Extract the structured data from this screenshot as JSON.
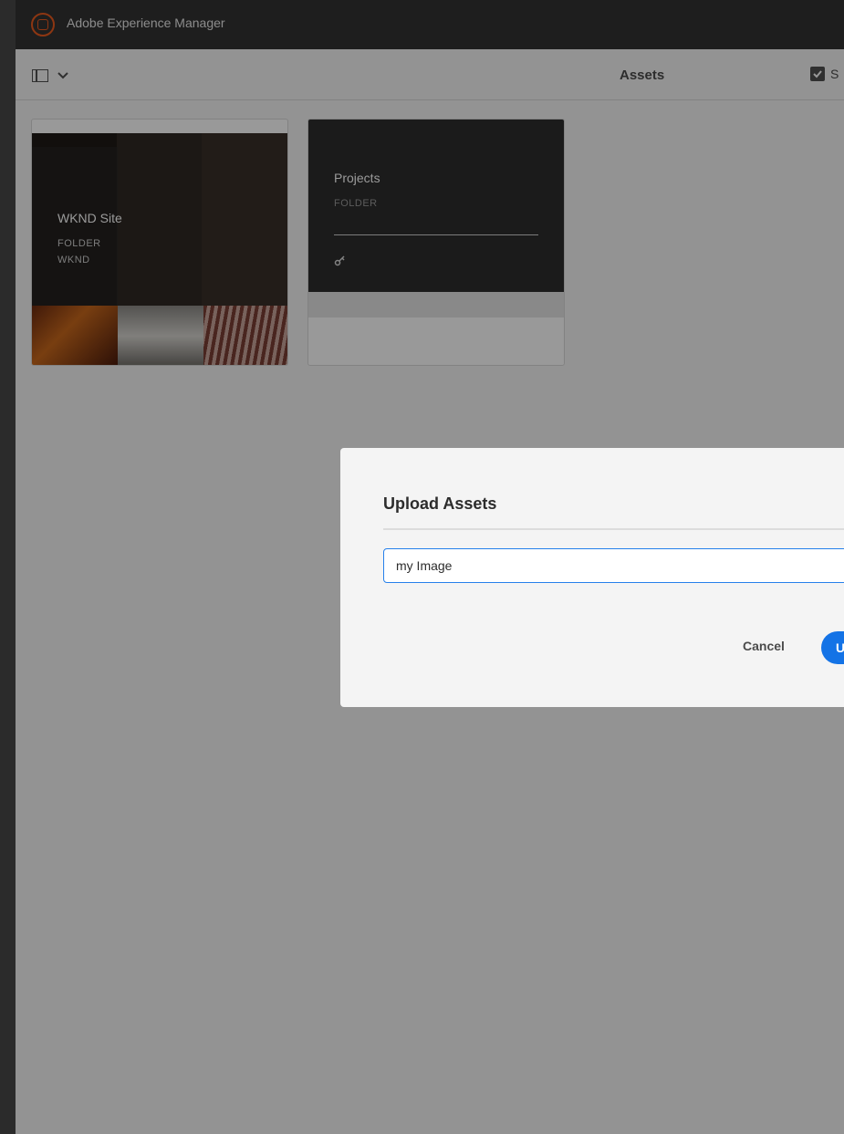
{
  "app": {
    "title": "Adobe Experience Manager",
    "logo_icon": "adobe-aem-icon"
  },
  "actionbar": {
    "page_title": "Assets",
    "rail_toggle_icon": "rail-toggle-icon",
    "select_label": "S"
  },
  "cards": [
    {
      "name": "WKND Site",
      "type": "FOLDER",
      "subtitle": "WKND"
    },
    {
      "name": "Projects",
      "type": "FOLDER",
      "icon": "key-icon"
    }
  ],
  "dialog": {
    "title": "Upload Assets",
    "input_value": "my Image",
    "cancel_label": "Cancel",
    "upload_label": "U"
  },
  "colors": {
    "accent": "#1473e6",
    "brand": "#eb5b1f",
    "topbar": "#323232"
  }
}
